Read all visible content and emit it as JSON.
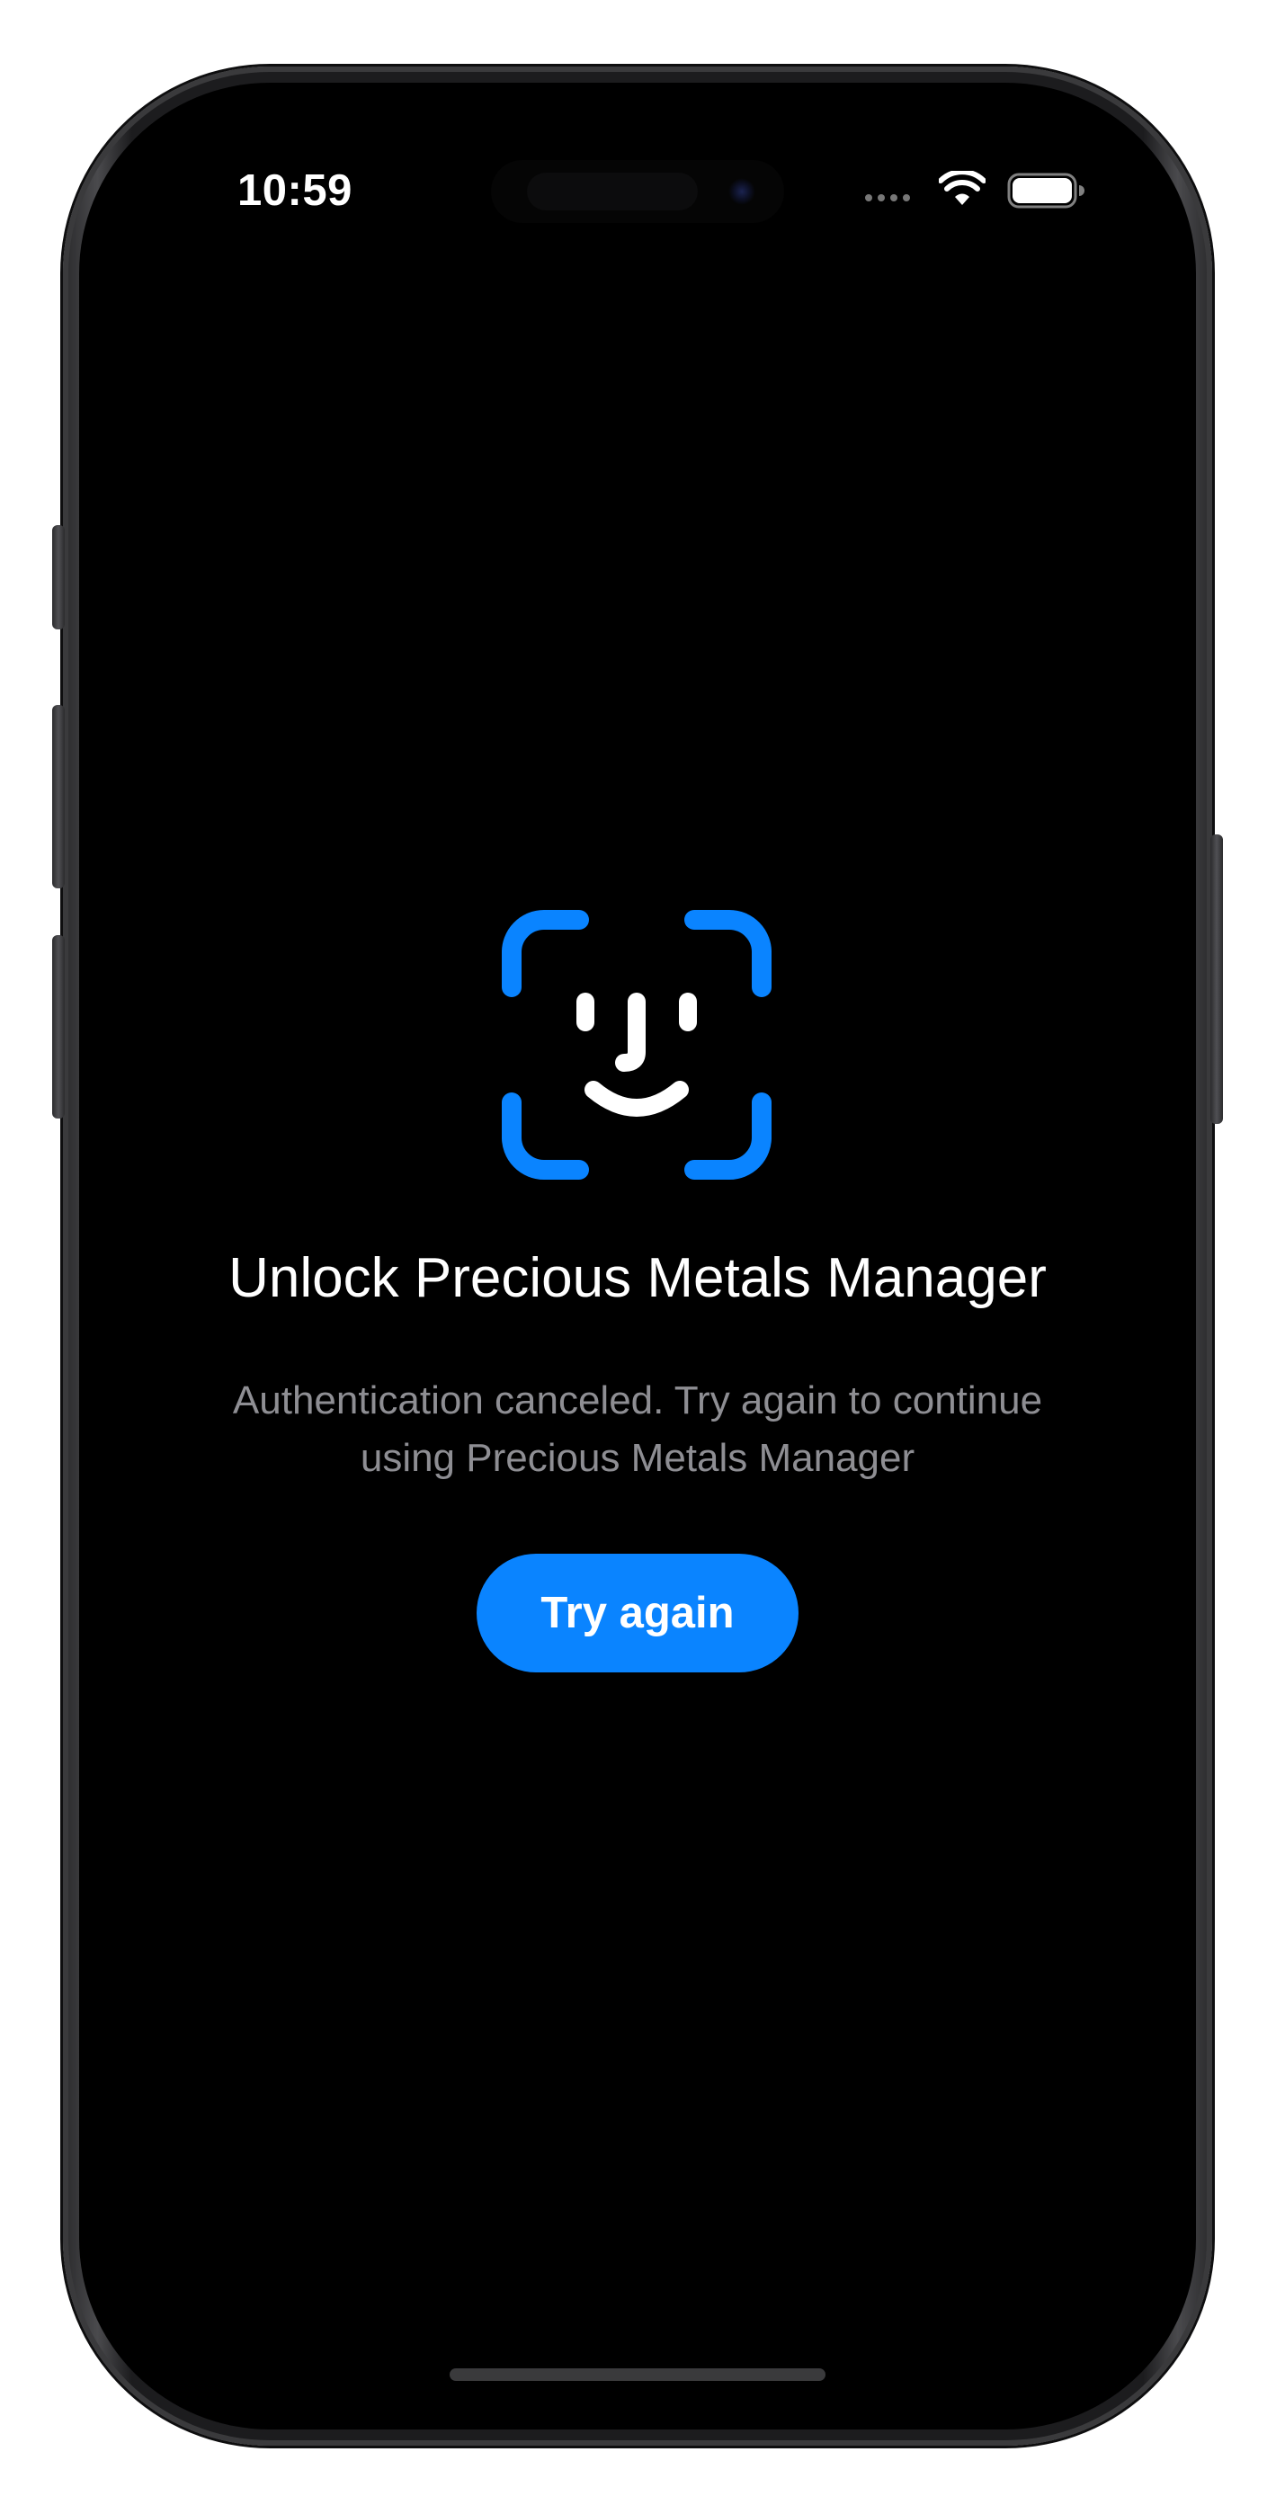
{
  "status_bar": {
    "time": "10:59"
  },
  "lock_screen": {
    "title": "Unlock Precious Metals Manager",
    "message": "Authentication canceled. Try again to continue using Precious Metals Manager",
    "retry_button_label": "Try again"
  },
  "icons": {
    "face_id": "face-id-icon",
    "wifi": "wifi-icon",
    "battery": "battery-icon"
  },
  "colors": {
    "accent": "#0a84ff",
    "background": "#000000",
    "title_text": "#ffffff",
    "message_text": "#8e8e93"
  }
}
